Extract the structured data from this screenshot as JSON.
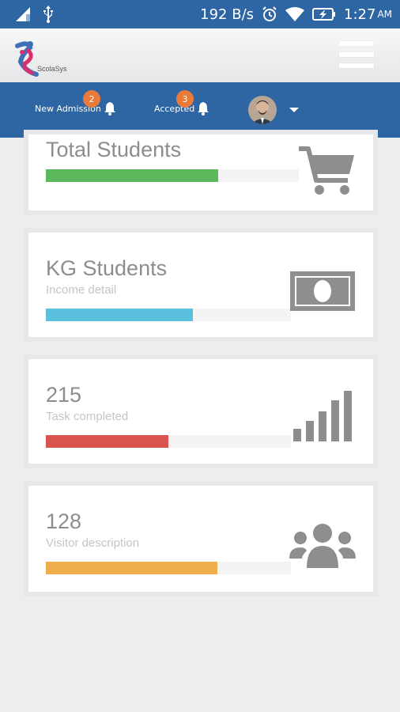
{
  "status_bar": {
    "speed": "192 B/s",
    "time": "1:27",
    "ampm": "AM",
    "icons": [
      "signal-icon",
      "usb-icon",
      "alarm-icon",
      "wifi-icon",
      "battery-icon"
    ]
  },
  "header": {
    "logo_text": "ScolaSys",
    "menu_icon": "hamburger-icon"
  },
  "notifications": [
    {
      "label": "New Admission",
      "count": "2",
      "icon": "bell-icon"
    },
    {
      "label": "Accepted",
      "count": "3",
      "icon": "bell-icon"
    }
  ],
  "profile": {
    "avatar_icon": "avatar",
    "menu_icon": "caret-down-icon"
  },
  "cards": [
    {
      "title": "Total Students",
      "subtitle": "",
      "progress": 0.68,
      "bar_color": "#5cb85c",
      "icon": "cart-icon"
    },
    {
      "title": "KG Students",
      "subtitle": "Income detail",
      "progress": 0.6,
      "bar_color": "#5bc0de",
      "icon": "money-icon"
    },
    {
      "title": "215",
      "subtitle": "Task completed",
      "progress": 0.5,
      "bar_color": "#d9534f",
      "icon": "bar-signal-icon"
    },
    {
      "title": "128",
      "subtitle": "Visitor description",
      "progress": 0.7,
      "bar_color": "#f0ad4e",
      "icon": "users-icon"
    }
  ],
  "colors": {
    "primary": "#2e66a4",
    "badge": "#e97a3a",
    "icon_gray": "#8e8e8e"
  }
}
